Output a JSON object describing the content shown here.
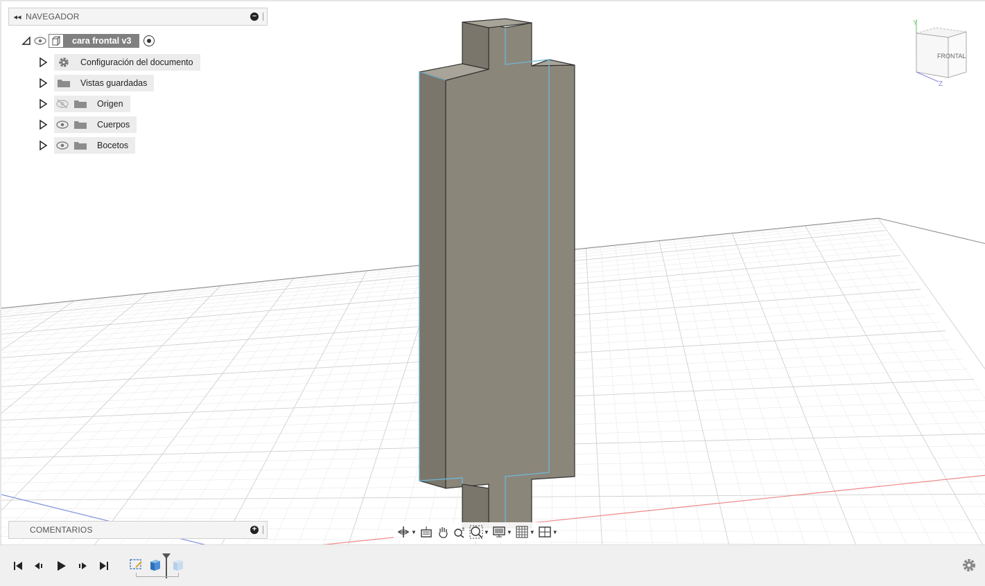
{
  "navigator": {
    "title": "NAVEGADOR",
    "root": {
      "label": "cara frontal v3"
    },
    "items": [
      {
        "label": "Configuración del documento",
        "icon": "gear-icon",
        "visible": null
      },
      {
        "label": "Vistas guardadas",
        "icon": "folder-icon",
        "visible": null
      },
      {
        "label": "Origen",
        "icon": "folder-icon",
        "visible": false
      },
      {
        "label": "Cuerpos",
        "icon": "folder-icon",
        "visible": true
      },
      {
        "label": "Bocetos",
        "icon": "folder-icon",
        "visible": true
      }
    ]
  },
  "comments": {
    "title": "COMENTARIOS"
  },
  "viewcube": {
    "face_label": "FRONTAL",
    "axis_y": "Y",
    "axis_z": "Z"
  },
  "toolbar": {
    "buttons": [
      "orbit-icon",
      "look-at-icon",
      "pan-icon",
      "zoom-icon",
      "fit-icon",
      "display-settings-icon",
      "grid-settings-icon",
      "viewports-icon"
    ]
  },
  "timeline": {
    "controls": [
      "go-to-start-icon",
      "step-back-icon",
      "play-icon",
      "step-forward-icon",
      "go-to-end-icon"
    ]
  },
  "colors": {
    "body_face": "#8a8579",
    "body_edge": "#3a3a3a",
    "highlight_edge": "#6fb8d8",
    "grid_line": "#dcdcdc",
    "x_axis": "#e07070",
    "z_axis": "#7a88d8"
  }
}
